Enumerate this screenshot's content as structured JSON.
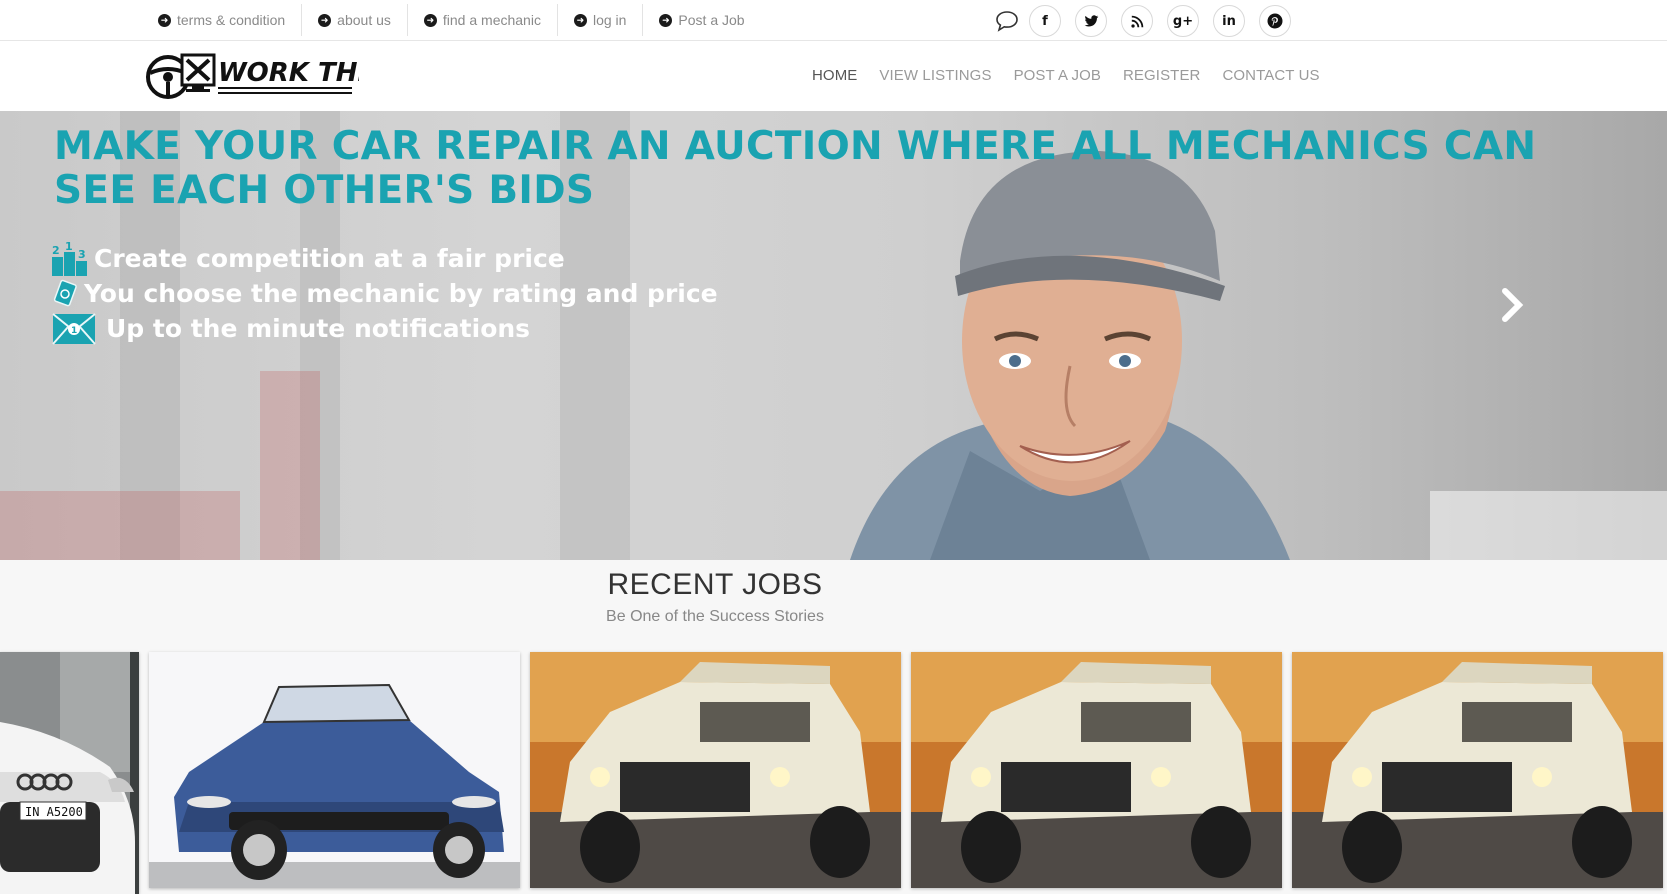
{
  "topbar": {
    "links": [
      {
        "label": "terms & condition",
        "icon": "arrow-circle-right-icon"
      },
      {
        "label": "about us",
        "icon": "arrow-circle-right-icon"
      },
      {
        "label": "find a mechanic",
        "icon": "arrow-circle-right-icon"
      },
      {
        "label": "log in",
        "icon": "arrow-circle-right-icon"
      },
      {
        "label": "Post a Job",
        "icon": "arrow-circle-right-icon"
      }
    ],
    "social": {
      "chat_icon": "chat-bubble-icon",
      "items": [
        {
          "name": "facebook-icon",
          "glyph": "f"
        },
        {
          "name": "twitter-icon",
          "glyph": ""
        },
        {
          "name": "rss-icon",
          "glyph": ""
        },
        {
          "name": "google-plus-icon",
          "glyph": "g+"
        },
        {
          "name": "linkedin-icon",
          "glyph": "in"
        },
        {
          "name": "pinterest-icon",
          "glyph": "p"
        }
      ]
    }
  },
  "header": {
    "logo_text": "WORK THIS",
    "nav": [
      "HOME",
      "VIEW LISTINGS",
      "POST A JOB",
      "REGISTER",
      "CONTACT US"
    ],
    "active_nav": "HOME"
  },
  "hero": {
    "title": "MAKE YOUR CAR REPAIR AN AUCTION WHERE ALL MECHANICS CAN SEE EACH OTHER'S BIDS",
    "features": [
      {
        "text": "Create competition at a fair price",
        "icon": "podium-icon"
      },
      {
        "text": "You choose the mechanic by rating and price",
        "icon": "money-icon"
      },
      {
        "text": "Up to the minute notifications",
        "icon": "envelope-icon"
      }
    ],
    "accent_color": "#1aa3b1",
    "next_icon": "chevron-right-icon"
  },
  "recent": {
    "title": "RECENT JOBS",
    "subtitle": "Be One of the Success Stories",
    "thumbnails": [
      {
        "name": "audi-white-car-image",
        "plate": "IN A5200"
      },
      {
        "name": "blue-convertible-car-image"
      },
      {
        "name": "hummer-truck-image"
      },
      {
        "name": "hummer-truck-image"
      },
      {
        "name": "hummer-truck-image"
      }
    ]
  }
}
